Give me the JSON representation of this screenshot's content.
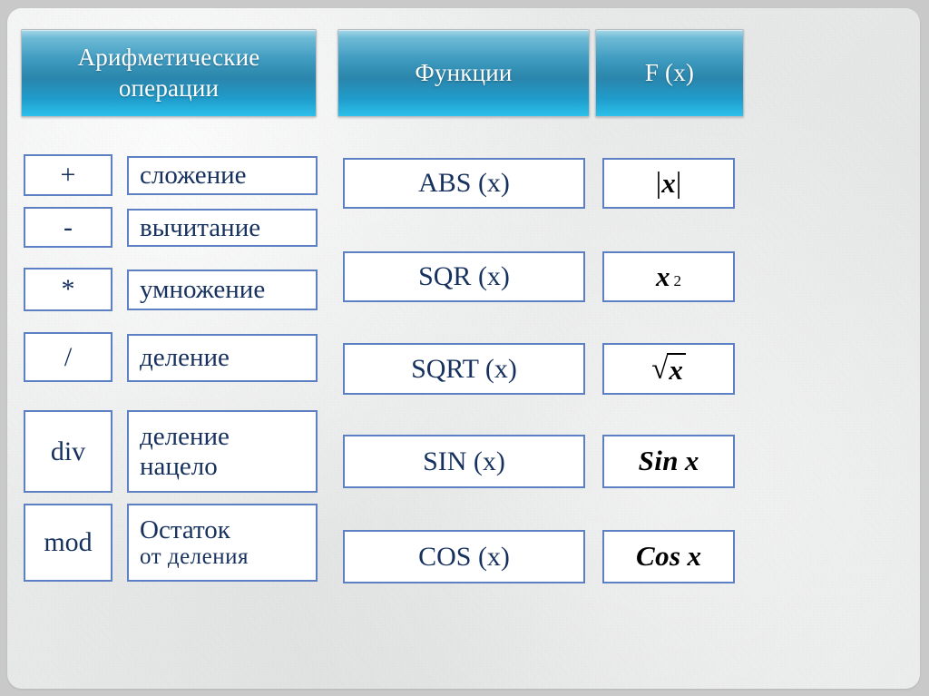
{
  "slide": {
    "background_color": "#e8e9e9",
    "frame_color": "#c9c9c9"
  },
  "headers": {
    "accent_color": "#2b85ac",
    "text_color": "#ffffff",
    "arithmetic_operations": "Арифметические операции",
    "functions": "Функции",
    "fx": "F (x)"
  },
  "cell_style": {
    "border_color": "#5d80c4",
    "fill_color": "#ffffff",
    "text_color": "#17315f"
  },
  "operations": [
    {
      "symbol": "+",
      "description": "сложение"
    },
    {
      "symbol": "-",
      "description": "вычитание"
    },
    {
      "symbol": "*",
      "description": "умножение"
    },
    {
      "symbol": "/",
      "description": "деление"
    },
    {
      "symbol": "div",
      "description_line1": "деление",
      "description_line2": "нацело"
    },
    {
      "symbol": "mod",
      "description_line1": "Остаток",
      "description_line2": "от  деления"
    }
  ],
  "functions": [
    {
      "name": "ABS (x)",
      "fx": "|x|"
    },
    {
      "name": "SQR (x)",
      "fx": "x 2"
    },
    {
      "name": "SQRT (x)",
      "fx": "√x"
    },
    {
      "name": "SIN (x)",
      "fx": "Sin x"
    },
    {
      "name": "COS (x)",
      "fx": "Cos x"
    }
  ],
  "fx_parts": {
    "abs_bar": "|",
    "abs_var": "x",
    "sqr_var": "x",
    "sqr_exp": "2",
    "sqrt_sign": "√",
    "sqrt_var": "x",
    "sin_name": "Sin",
    "sin_var": "x",
    "cos_name": "Cos",
    "cos_var": "x"
  }
}
